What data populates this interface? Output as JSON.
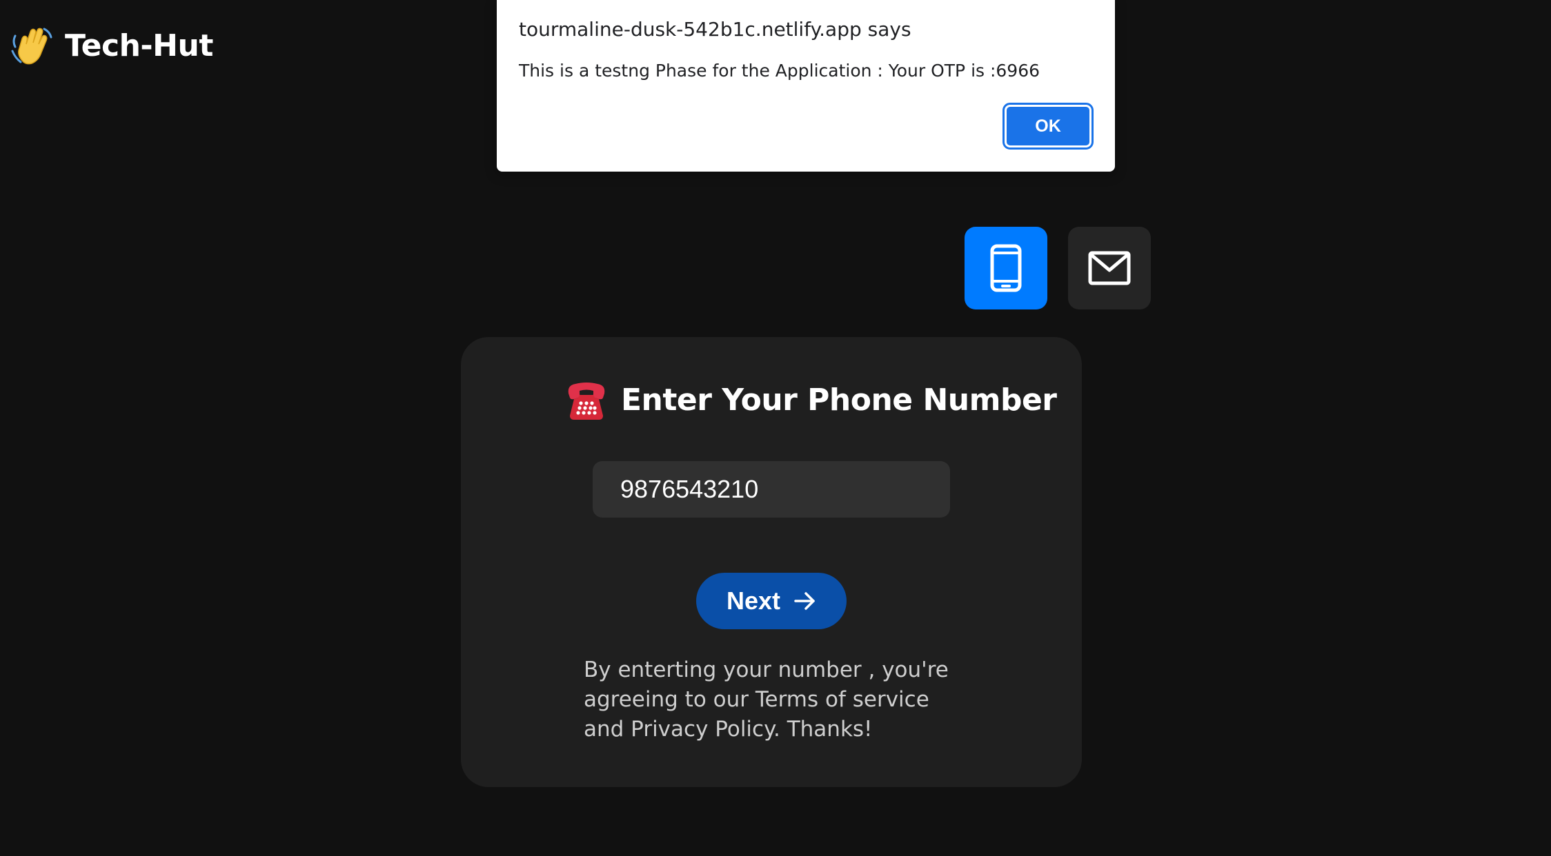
{
  "brand": {
    "name": "Tech-Hut",
    "icon": "waving-hand-icon"
  },
  "alert": {
    "title": "tourmaline-dusk-542b1c.netlify.app says",
    "message": "This is a testng Phase for the Application : Your OTP is :6966",
    "ok_label": "OK",
    "ok_color": "#1a73e8"
  },
  "mode_toggle": {
    "phone_icon": "smartphone-icon",
    "email_icon": "envelope-icon",
    "active": "phone",
    "active_color": "#007bff"
  },
  "card": {
    "title_icon": "telephone-icon",
    "title": "Enter Your Phone Number",
    "phone_value": "9876543210",
    "next_label": "Next",
    "next_icon": "arrow-right-icon",
    "next_color": "#0a4fa8",
    "terms": "By enterting your number , you're agreeing to our Terms of service and Privacy Policy. Thanks!"
  }
}
